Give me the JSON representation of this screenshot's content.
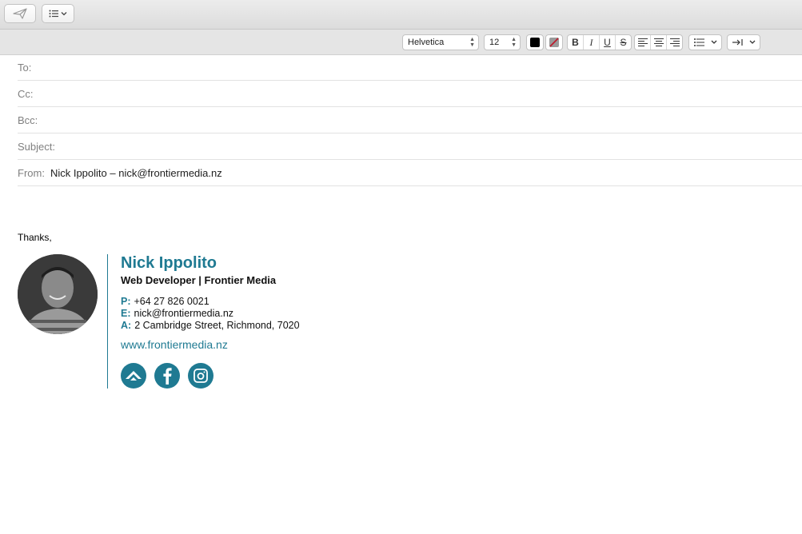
{
  "toolbar": {
    "send_icon": "paper-plane-icon",
    "list_icon": "list-menu-icon"
  },
  "format_bar": {
    "font": "Helvetica",
    "size": "12",
    "text_color": "#000000",
    "style_buttons": [
      "B",
      "I",
      "U",
      "S"
    ],
    "align_icons": [
      "align-left-icon",
      "align-center-icon",
      "align-right-icon"
    ],
    "list_icon": "bullet-list-icon",
    "indent_icon": "indent-icon"
  },
  "header_fields": {
    "to_label": "To:",
    "to_value": "",
    "cc_label": "Cc:",
    "cc_value": "",
    "bcc_label": "Bcc:",
    "bcc_value": "",
    "subject_label": "Subject:",
    "subject_value": "",
    "from_label": "From:",
    "from_value": "Nick Ippolito – nick@frontiermedia.nz"
  },
  "body": {
    "greeting": "Thanks,"
  },
  "signature": {
    "name": "Nick Ippolito",
    "title": "Web Developer | Frontier Media",
    "phone_label": "P:",
    "phone": "+64 27 826 0021",
    "email_label": "E:",
    "email": "nick@frontiermedia.nz",
    "address_label": "A:",
    "address": "2 Cambridge Street, Richmond, 7020",
    "website": "www.frontiermedia.nz",
    "brand_color": "#1f7a92",
    "social_icons": [
      "frontier-logo-icon",
      "facebook-icon",
      "instagram-icon"
    ]
  }
}
